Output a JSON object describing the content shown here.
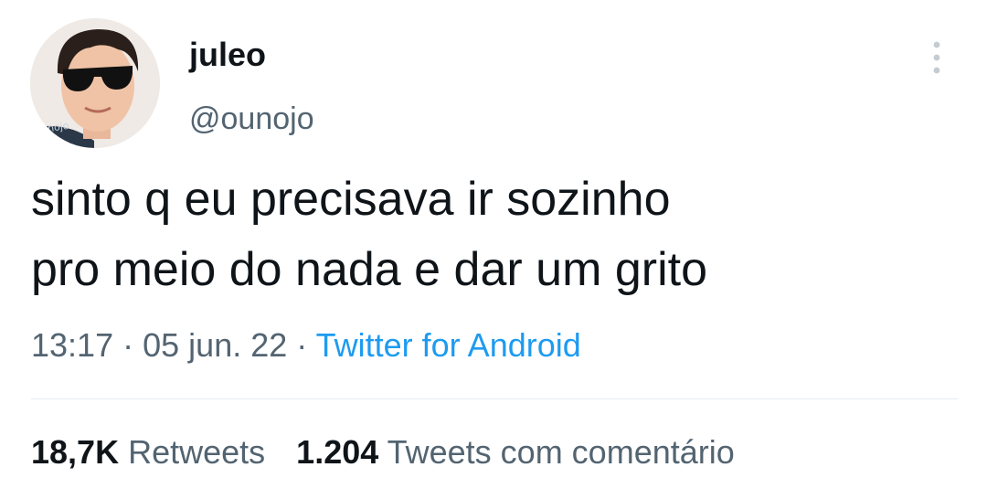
{
  "user": {
    "display_name": "juleo",
    "handle": "@ounojo",
    "avatar_watermark": "ounojo"
  },
  "tweet": {
    "text": "sinto q eu precisava ir sozinho\npro meio do nada  e dar um grito",
    "time": "13:17",
    "separator": "·",
    "date": "05 jun. 22",
    "source": "Twitter for Android"
  },
  "stats": {
    "retweets_count": "18,7K",
    "retweets_label": "Retweets",
    "quotes_count": "1.204",
    "quotes_label": "Tweets com comentário"
  },
  "icons": {
    "more": "more-vertical-icon"
  },
  "colors": {
    "text": "#0f1419",
    "secondary": "#536471",
    "link": "#1d9bf0",
    "divider": "#e6ebee"
  }
}
